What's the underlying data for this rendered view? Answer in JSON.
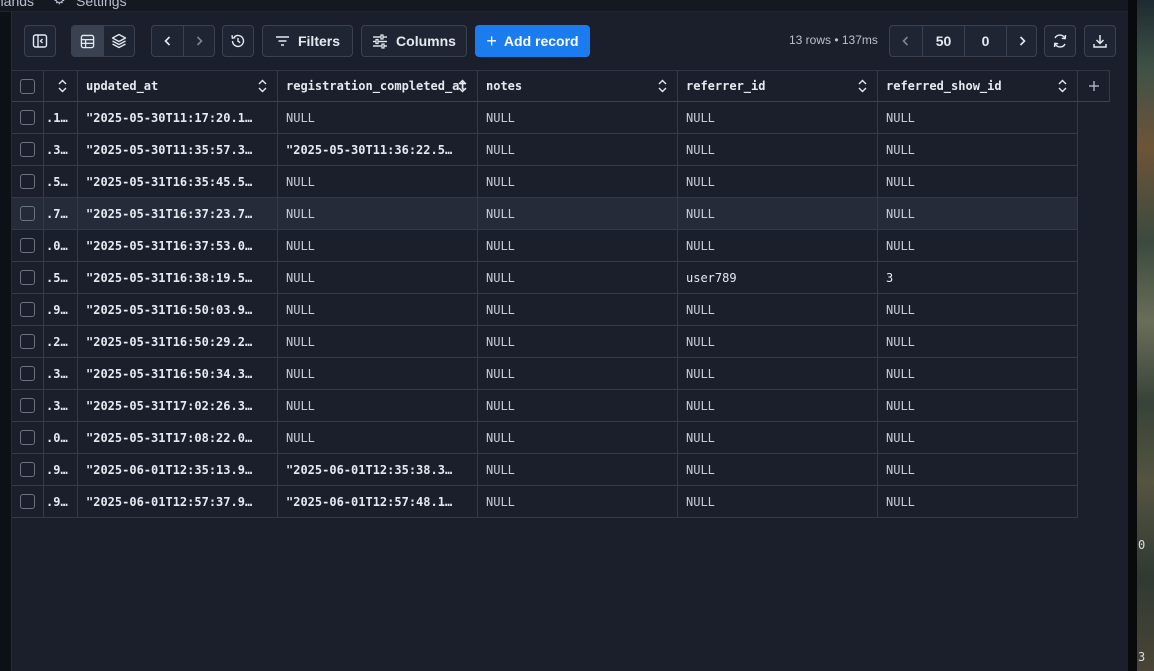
{
  "topbar": {
    "left_label": "mands",
    "settings_label": "Settings"
  },
  "toolbar": {
    "filters_label": "Filters",
    "columns_label": "Columns",
    "add_record_label": "Add record",
    "stats": "13 rows • 137ms",
    "page_limit": "50",
    "page_offset": "0"
  },
  "table": {
    "columns": [
      "",
      "updated_at",
      "registration_completed_at",
      "notes",
      "referrer_id",
      "referred_show_id"
    ],
    "rows": [
      [
        ".1…",
        "\"2025-05-30T11:17:20.1…",
        "NULL",
        "NULL",
        "NULL",
        "NULL"
      ],
      [
        ".3…",
        "\"2025-05-30T11:35:57.3…",
        "\"2025-05-30T11:36:22.5…",
        "NULL",
        "NULL",
        "NULL"
      ],
      [
        ".5…",
        "\"2025-05-31T16:35:45.5…",
        "NULL",
        "NULL",
        "NULL",
        "NULL"
      ],
      [
        ".7…",
        "\"2025-05-31T16:37:23.7…",
        "NULL",
        "NULL",
        "NULL",
        "NULL"
      ],
      [
        ".0…",
        "\"2025-05-31T16:37:53.0…",
        "NULL",
        "NULL",
        "NULL",
        "NULL"
      ],
      [
        ".5…",
        "\"2025-05-31T16:38:19.5…",
        "NULL",
        "NULL",
        "user789",
        "3"
      ],
      [
        ".9…",
        "\"2025-05-31T16:50:03.9…",
        "NULL",
        "NULL",
        "NULL",
        "NULL"
      ],
      [
        ".2…",
        "\"2025-05-31T16:50:29.2…",
        "NULL",
        "NULL",
        "NULL",
        "NULL"
      ],
      [
        ".3…",
        "\"2025-05-31T16:50:34.3…",
        "NULL",
        "NULL",
        "NULL",
        "NULL"
      ],
      [
        ".3…",
        "\"2025-05-31T17:02:26.3…",
        "NULL",
        "NULL",
        "NULL",
        "NULL"
      ],
      [
        ".0…",
        "\"2025-05-31T17:08:22.0…",
        "NULL",
        "NULL",
        "NULL",
        "NULL"
      ],
      [
        ".9…",
        "\"2025-06-01T12:35:13.9…",
        "\"2025-06-01T12:35:38.3…",
        "NULL",
        "NULL",
        "NULL"
      ],
      [
        ".9…",
        "\"2025-06-01T12:57:37.9…",
        "\"2025-06-01T12:57:48.1…",
        "NULL",
        "NULL",
        "NULL"
      ]
    ]
  },
  "right_strip": {
    "values": [
      "0",
      "3"
    ]
  },
  "colors": {
    "accent": "#1b7cf0",
    "background": "#1a1f2b",
    "border": "#343b48"
  }
}
